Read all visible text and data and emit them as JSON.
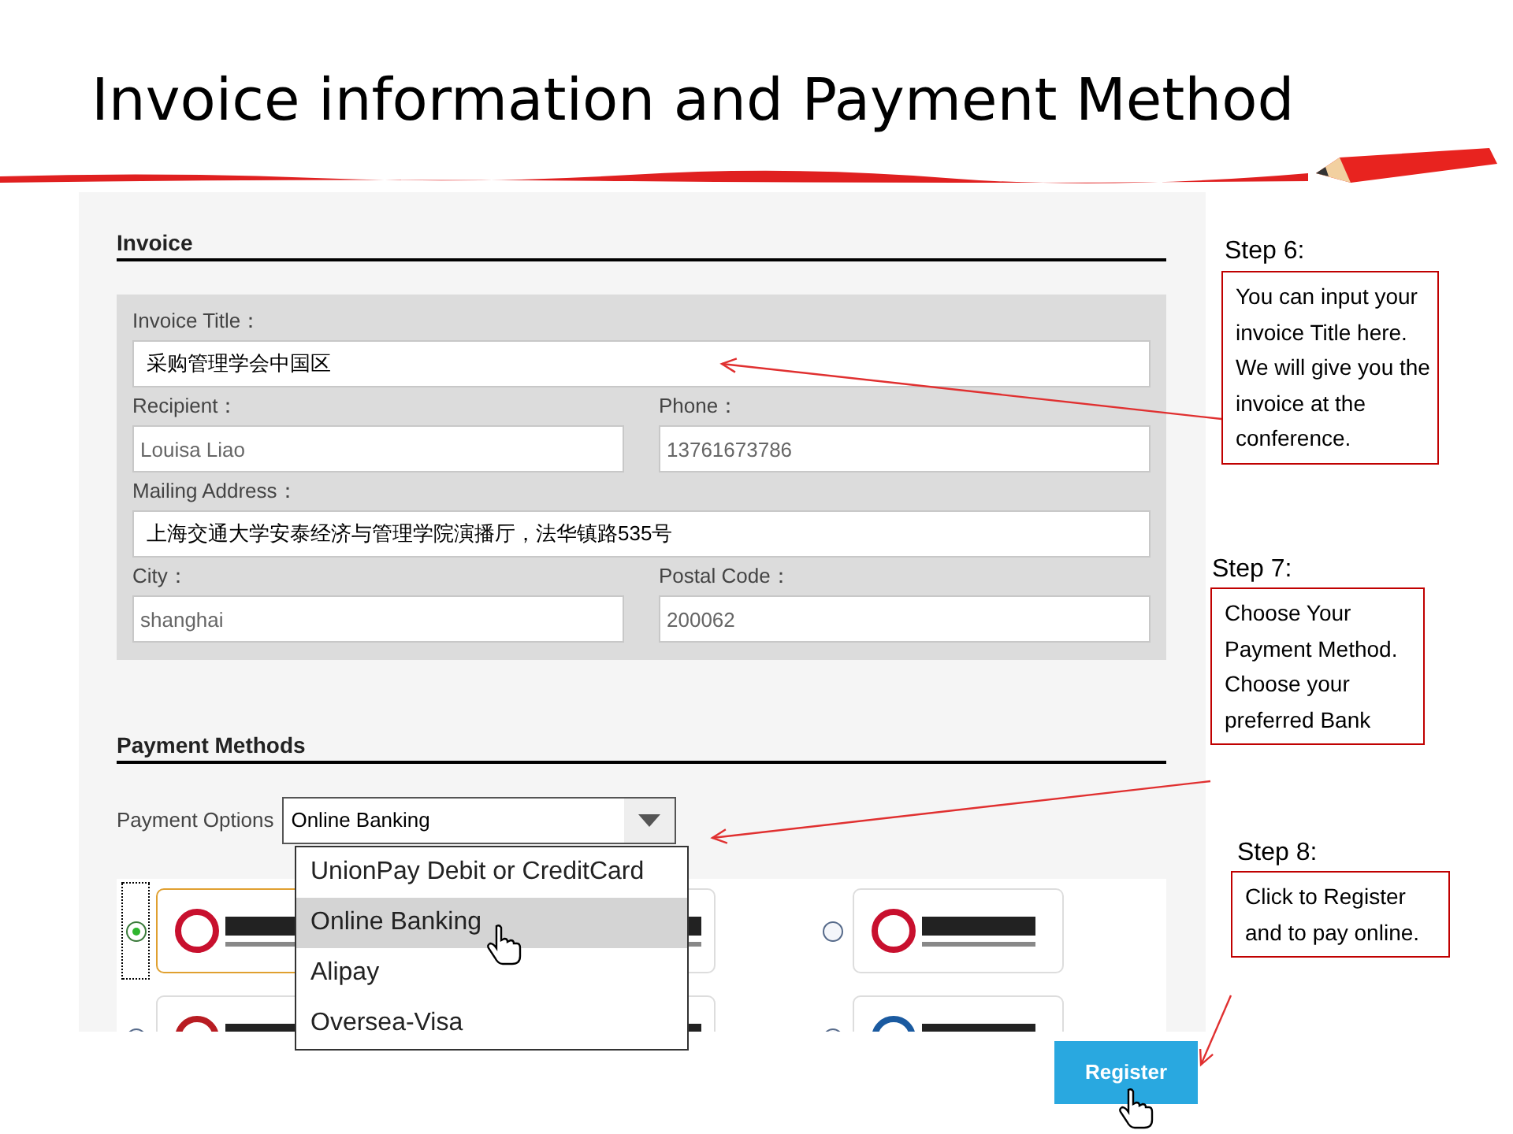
{
  "slide": {
    "title": "Invoice information and Payment Method"
  },
  "invoice": {
    "heading": "Invoice",
    "rows": [
      [
        {
          "label": "Invoice Title：",
          "value": "采购管理学会中国区"
        }
      ],
      [
        {
          "label": "Recipient：",
          "value": "Louisa Liao"
        },
        {
          "label": "Phone：",
          "value": "13761673786"
        }
      ],
      [
        {
          "label": "Mailing Address：",
          "value": "上海交通大学安泰经济与管理学院演播厅，法华镇路535号"
        }
      ],
      [
        {
          "label": "City：",
          "value": "shanghai"
        },
        {
          "label": "Postal Code：",
          "value": "200062"
        }
      ]
    ]
  },
  "payment": {
    "heading": "Payment Methods",
    "options_label": "Payment Options",
    "select_value": "Online Banking",
    "options": [
      {
        "label": "UnionPay Debit or CreditCard",
        "selected": false
      },
      {
        "label": "Online Banking",
        "selected": true
      },
      {
        "label": "Alipay",
        "selected": false
      },
      {
        "label": "Oversea-Visa",
        "selected": false
      }
    ],
    "bank_radios": [
      {
        "selected": true
      },
      {
        "selected": false
      },
      {
        "selected": false
      },
      {
        "selected": false
      }
    ]
  },
  "register_button": "Register",
  "callouts": [
    {
      "step": "Step 6:",
      "text": "You can input your invoice Title here.  We will give you the invoice at the conference."
    },
    {
      "step": "Step 7:",
      "text": "Choose Your Payment Method. Choose your preferred Bank"
    },
    {
      "step": "Step 8:",
      "text": "Click to Register and to pay online."
    }
  ]
}
